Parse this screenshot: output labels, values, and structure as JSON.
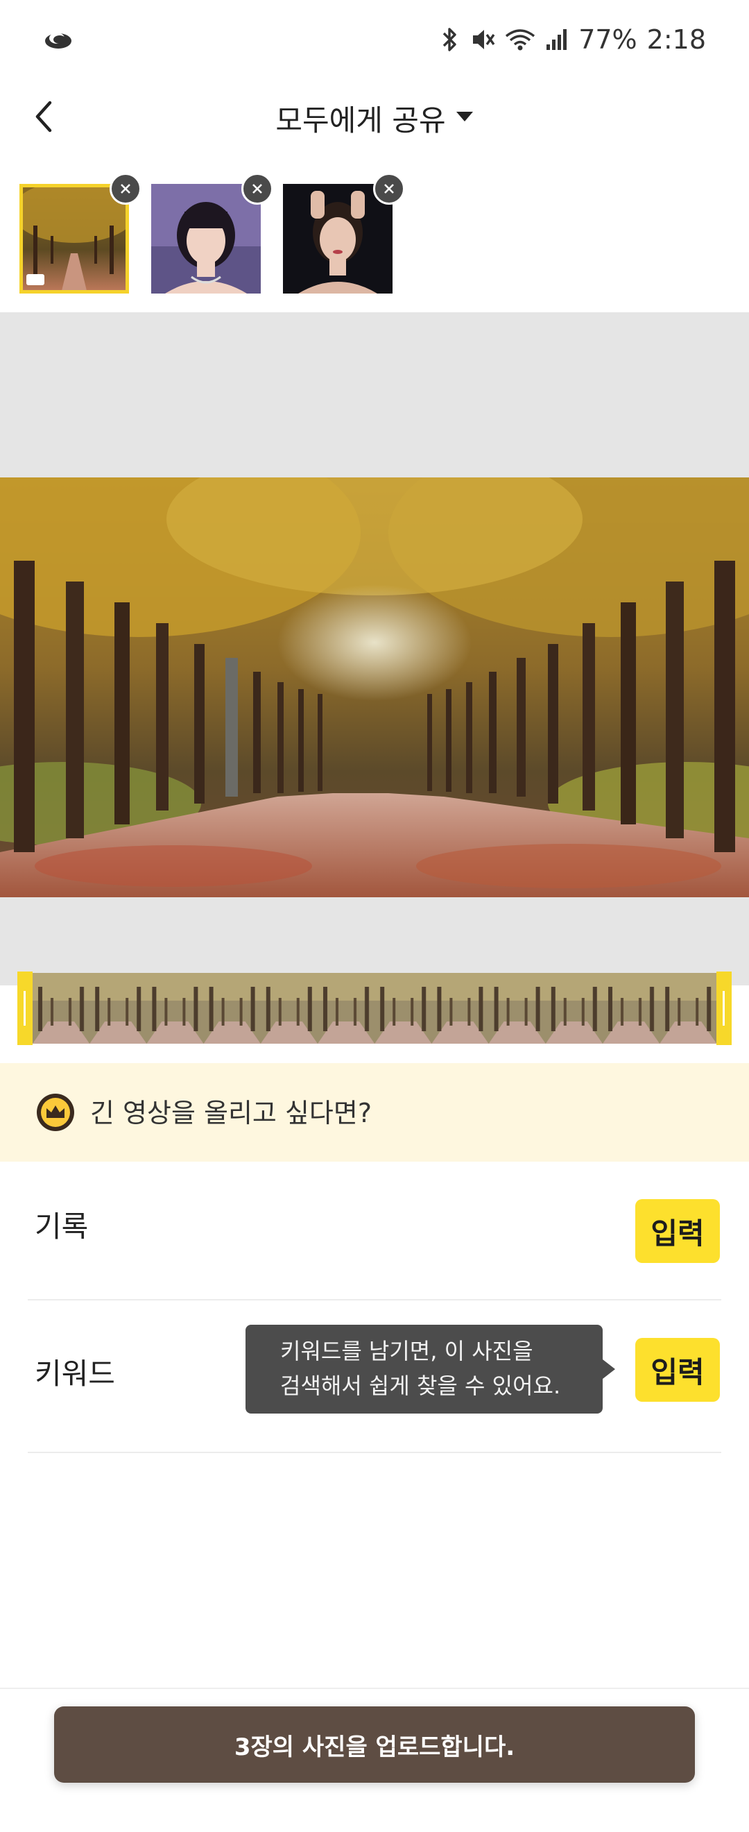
{
  "status_bar": {
    "battery": "77%",
    "time": "2:18",
    "icons": [
      "bluetooth-icon",
      "mute-icon",
      "wifi-icon",
      "signal-icon"
    ]
  },
  "header": {
    "title": "모두에게 공유",
    "icons": [
      "back-arrow-icon",
      "dropdown-caret-icon"
    ]
  },
  "thumbnails": [
    {
      "name": "autumn-road",
      "selected": true
    },
    {
      "name": "portrait-1",
      "selected": false
    },
    {
      "name": "portrait-2",
      "selected": false
    }
  ],
  "premium_banner": {
    "text": "긴 영상을 올리고 싶다면?",
    "icon": "crown-icon"
  },
  "rows": {
    "record": {
      "label": "기록",
      "button": "입력"
    },
    "keyword": {
      "label": "키워드",
      "button": "입력"
    }
  },
  "tooltip": {
    "line1": "키워드를 남기면, 이 사진을",
    "line2": "검색해서 쉽게 찾을 수 있어요."
  },
  "upload_button": "3장의 사진을 업로드합니다.",
  "colors": {
    "accent_yellow": "#fde02d",
    "upload_brown": "#5e4d43",
    "banner_bg": "#fef7df",
    "preview_bg": "#e5e5e5"
  }
}
